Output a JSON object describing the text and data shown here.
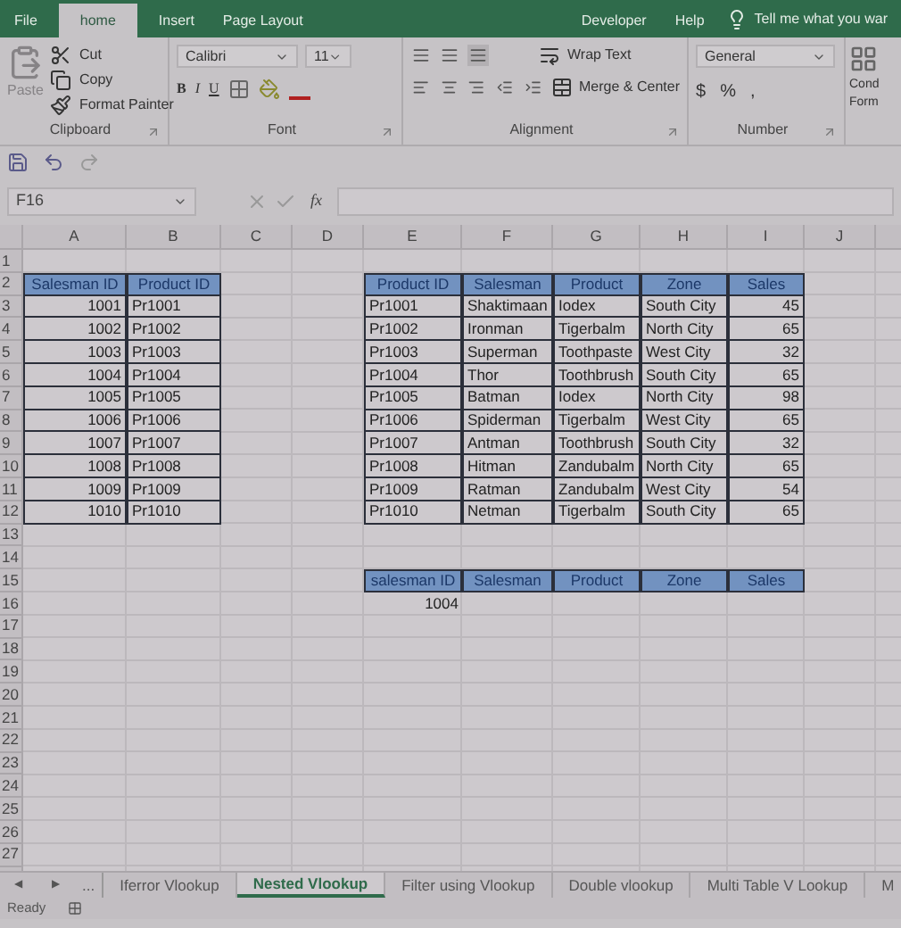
{
  "ribbon_tabs": [
    {
      "label": "File",
      "selected": false
    },
    {
      "label": "home",
      "selected": true
    },
    {
      "label": "Insert",
      "selected": false
    },
    {
      "label": "Page Layout",
      "selected": false
    },
    {
      "label": "Developer",
      "selected": false
    },
    {
      "label": "Help",
      "selected": false
    }
  ],
  "tell_me": "Tell me what you war",
  "clipboard": {
    "paste": "Paste",
    "paste_disabled": true,
    "cut": "Cut",
    "copy": "Copy",
    "format_painter": "Format Painter",
    "label": "Clipboard"
  },
  "font": {
    "name": "Calibri",
    "size": "11",
    "bold": "B",
    "italic": "I",
    "underline": "U",
    "label": "Font"
  },
  "alignment": {
    "wrap_text": "Wrap Text",
    "merge": "Merge & Center",
    "label": "Alignment"
  },
  "number": {
    "format": "General",
    "currency": "$",
    "percent": "%",
    "comma": ",",
    "label": "Number"
  },
  "conditional_formatting": [
    "Cond",
    "Form"
  ],
  "name_box": "F16",
  "function_label": "fx",
  "columns": [
    "A",
    "B",
    "C",
    "D",
    "E",
    "F",
    "G",
    "H",
    "I",
    "J"
  ],
  "row_numbers": [
    "1",
    "2",
    "3",
    "4",
    "5",
    "6",
    "7",
    "8",
    "9",
    "10",
    "11",
    "12",
    "13",
    "14",
    "15",
    "16",
    "17",
    "18",
    "19",
    "20",
    "21",
    "22",
    "23",
    "24",
    "25",
    "26",
    "27"
  ],
  "tables": [
    {
      "columns": [
        {
          "label": "Salesman ID",
          "numeric": true
        },
        {
          "label": "Product ID",
          "numeric": false
        }
      ],
      "rows": [
        [
          "1001",
          "Pr1001"
        ],
        [
          "1002",
          "Pr1002"
        ],
        [
          "1003",
          "Pr1003"
        ],
        [
          "1004",
          "Pr1004"
        ],
        [
          "1005",
          "Pr1005"
        ],
        [
          "1006",
          "Pr1006"
        ],
        [
          "1007",
          "Pr1007"
        ],
        [
          "1008",
          "Pr1008"
        ],
        [
          "1009",
          "Pr1009"
        ],
        [
          "1010",
          "Pr1010"
        ]
      ]
    },
    {
      "columns": [
        {
          "label": "Product ID",
          "numeric": false
        },
        {
          "label": "Salesman",
          "numeric": false
        },
        {
          "label": "Product",
          "numeric": false
        },
        {
          "label": "Zone",
          "numeric": false
        },
        {
          "label": "Sales",
          "numeric": true
        }
      ],
      "rows": [
        [
          "Pr1001",
          "Shaktimaan",
          "Iodex",
          "South City",
          "45"
        ],
        [
          "Pr1002",
          "Ironman",
          "Tigerbalm",
          "North City",
          "65"
        ],
        [
          "Pr1003",
          "Superman",
          "Toothpaste",
          "West City",
          "32"
        ],
        [
          "Pr1004",
          "Thor",
          "Toothbrush",
          "South City",
          "65"
        ],
        [
          "Pr1005",
          "Batman",
          "Iodex",
          "North City",
          "98"
        ],
        [
          "Pr1006",
          "Spiderman",
          "Tigerbalm",
          "West City",
          "65"
        ],
        [
          "Pr1007",
          "Antman",
          "Toothbrush",
          "South City",
          "32"
        ],
        [
          "Pr1008",
          "Hitman",
          "Zandubalm",
          "North City",
          "65"
        ],
        [
          "Pr1009",
          "Ratman",
          "Zandubalm",
          "West City",
          "54"
        ],
        [
          "Pr1010",
          "Netman",
          "Tigerbalm",
          "South City",
          "65"
        ]
      ]
    }
  ],
  "lookup": {
    "columns": [
      "salesman ID",
      "Salesman",
      "Product",
      "Zone",
      "Sales"
    ],
    "salesman_id": "1004"
  },
  "sheet_tabs": [
    {
      "label": "Iferror Vlookup",
      "selected": false
    },
    {
      "label": "Nested Vlookup",
      "selected": true
    },
    {
      "label": "Filter using Vlookup",
      "selected": false
    },
    {
      "label": "Double vlookup",
      "selected": false
    },
    {
      "label": "Multi Table V Lookup",
      "selected": false
    },
    {
      "label": "M",
      "selected": false
    }
  ],
  "sheet_nav": [
    "◀",
    "▶"
  ],
  "more_tabs": "...",
  "status": "Ready"
}
